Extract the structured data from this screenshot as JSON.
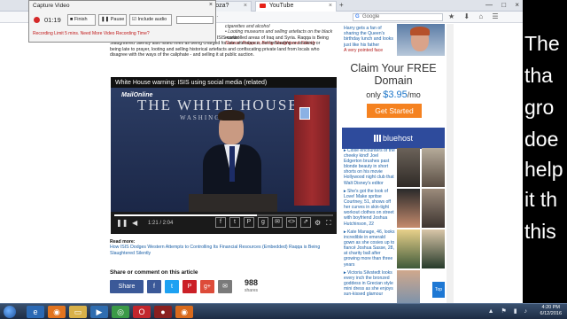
{
  "browser": {
    "tabs": [
      {
        "label": "Sloza?",
        "close": "×"
      },
      {
        "label": "YouTube",
        "close": "×"
      }
    ],
    "new_tab": "+",
    "window_controls": [
      "—",
      "□",
      "×"
    ],
    "url_end": "ckb...",
    "search_engine_glyph": "G",
    "search_placeholder": "Google",
    "nav_icons": "★ ⬇ ⌂ ☰"
  },
  "capture": {
    "title": "Capture Video",
    "close": "×",
    "time": "01:19",
    "finish_label": "Finish",
    "pause_label": "Pause",
    "audio_label": "Include audio",
    "warning": "Recording Limit 5 mins. Need More Video Recording Time?"
  },
  "article": {
    "intro": "ominent ways of obtaining cause on from tobacco in ISIS-controlled areas of Iraq and Syria. Raqqa is Being Slaughtered Silently also listed fines as being charged for late attendance, not beheading or smoking or being late to prayer, looting and selling historical artefacts and confiscating private land from locals who disagree with the ways of the caliphate - and selling it at public auction.",
    "side_quotes": "cigarettes and alcohol\n• Looting museums and selling artefacts on the black market",
    "side_source": "Source: Raqqa is Being Slaughtered Silently",
    "video_title": "White House warning: ISIS using social media (related)",
    "video_logo": "MailOnline",
    "video_scene_text": "THE WHITE HOUSE",
    "video_scene_sub": "WASHINGTON",
    "player_time": "1:21 / 2:04",
    "player_progress": 0.65,
    "player_icons": {
      "play": "❚❚",
      "volume": "◀",
      "settings": "⚙",
      "fullscreen": "⛶"
    },
    "share_icons": [
      "f",
      "t",
      "P",
      "g",
      "✉",
      "<>",
      "⇗"
    ],
    "read_more_heading": "Read more:",
    "read_more_link": "How ISIS Dodges Western Attempts to Controlling Its Financial Resources (Embedded) Raqqa is Being Slaughtered Silently",
    "share_title": "Share or comment on this article",
    "share_buttons": [
      "Share",
      "f",
      "t",
      "P",
      "g+",
      "✉"
    ],
    "share_count": "988",
    "share_count_label": "shares"
  },
  "rightcol": {
    "top_story": "Harry gets a fan of sharing the Queen's birthday lunch and looks just like his father",
    "top_story_flag": "A very pointed face",
    "ad": {
      "title": "Claim Your FREE Domain",
      "price_prefix": "only",
      "price": "$3.95",
      "price_suffix": "/mo",
      "button": "Get Started",
      "brand": "bluehost"
    },
    "items": [
      {
        "text": "Close encounters of the cheeky kind! Joel Edgerton brushes past blonde beauty in short shorts on his movie Hollywood night club that Walt Disney's editor"
      },
      {
        "text": "She's got the look of Love! Make spritse Courtney, 51, shows off her curves in skin-tight workout clothes on street with boyfriend Joshua Hutchinson, 22"
      },
      {
        "text": "Kate Manage, 46, looks incredible in emerald gown as she cosies up to fiancé Joshua Sasse, 28, at charity ball after growing more than three years"
      },
      {
        "text": "Victoria Silvstedt looks every inch the bronzed goddess in Grecian style mini dress as she enjoys sun-kissed glamour"
      }
    ],
    "top_button": "Top"
  },
  "black_panel": {
    "words": [
      "The",
      "tha",
      "gro",
      "doe",
      "help",
      "it th",
      "this"
    ]
  },
  "taskbar": {
    "icons": [
      "ie-icon",
      "firefox-icon",
      "folder-icon",
      "media-icon",
      "chrome-icon",
      "opera-icon",
      "video-icon",
      "firefox2-icon"
    ],
    "time": "4:20 PM",
    "date": "6/12/2016",
    "tray_icons": "▲ ⚑ ▮ ♪"
  }
}
